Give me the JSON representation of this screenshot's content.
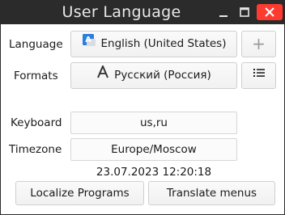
{
  "window": {
    "title": "User Language"
  },
  "language": {
    "label": "Language",
    "value": "English (United States)",
    "icon": "language-flag-icon"
  },
  "formats": {
    "label": "Formats",
    "value": "Русский (Россия)",
    "icon": "letter-a-icon"
  },
  "keyboard": {
    "label": "Keyboard",
    "value": "us,ru"
  },
  "timezone": {
    "label": "Timezone",
    "value": "Europe/Moscow"
  },
  "clock": {
    "datetime": "23.07.2023 12:20:18"
  },
  "buttons": {
    "add_symbol": "+",
    "localize_programs": "Localize Programs",
    "translate_menus": "Translate menus"
  },
  "colors": {
    "titlebar": "#2b2b2b",
    "close": "#ff3b30",
    "accent": "#2a7de1"
  }
}
